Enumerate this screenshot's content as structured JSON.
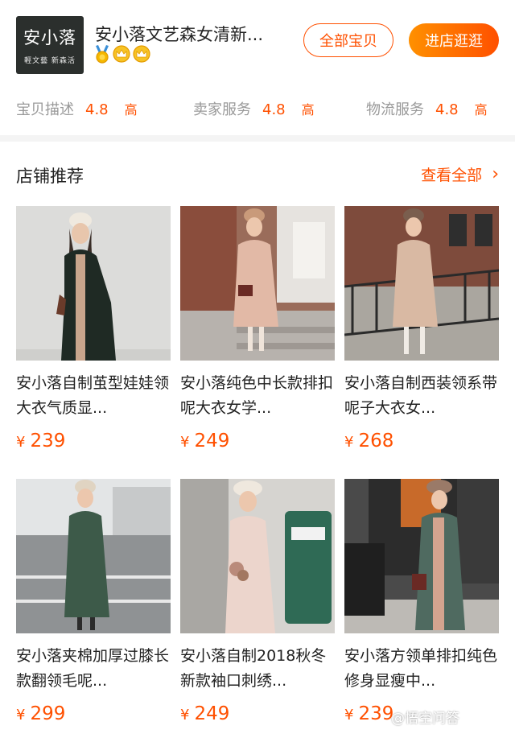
{
  "shop": {
    "logo_text": "安小落",
    "logo_subtext": "輕文藝 新森活",
    "name": "安小落文艺森女清新...",
    "all_items_label": "全部宝贝",
    "enter_shop_label": "进店逛逛",
    "badges": [
      "gold-medal-icon",
      "crown-icon",
      "crown-icon"
    ]
  },
  "ratings": [
    {
      "label": "宝贝描述",
      "value": "4.8",
      "level": "高"
    },
    {
      "label": "卖家服务",
      "value": "4.8",
      "level": "高"
    },
    {
      "label": "物流服务",
      "value": "4.8",
      "level": "高"
    }
  ],
  "section": {
    "title": "店铺推荐",
    "see_all": "查看全部"
  },
  "currency_symbol": "¥",
  "products": [
    {
      "name": "安小落自制茧型娃娃领大衣气质显...",
      "price": "239"
    },
    {
      "name": "安小落纯色中长款排扣呢大衣女学...",
      "price": "249"
    },
    {
      "name": "安小落自制西装领系带呢子大衣女...",
      "price": "268"
    },
    {
      "name": "安小落夹棉加厚过膝长款翻领毛呢...",
      "price": "299"
    },
    {
      "name": "安小落自制2018秋冬新款袖口刺绣...",
      "price": "249"
    },
    {
      "name": "安小落方领单排扣纯色修身显瘦中...",
      "price": "239"
    }
  ],
  "watermark": "@悟空问答",
  "colors": {
    "accent": "#ff5000",
    "accent_gradient_start": "#ff9000",
    "logo_bg": "#2b2f2d"
  }
}
